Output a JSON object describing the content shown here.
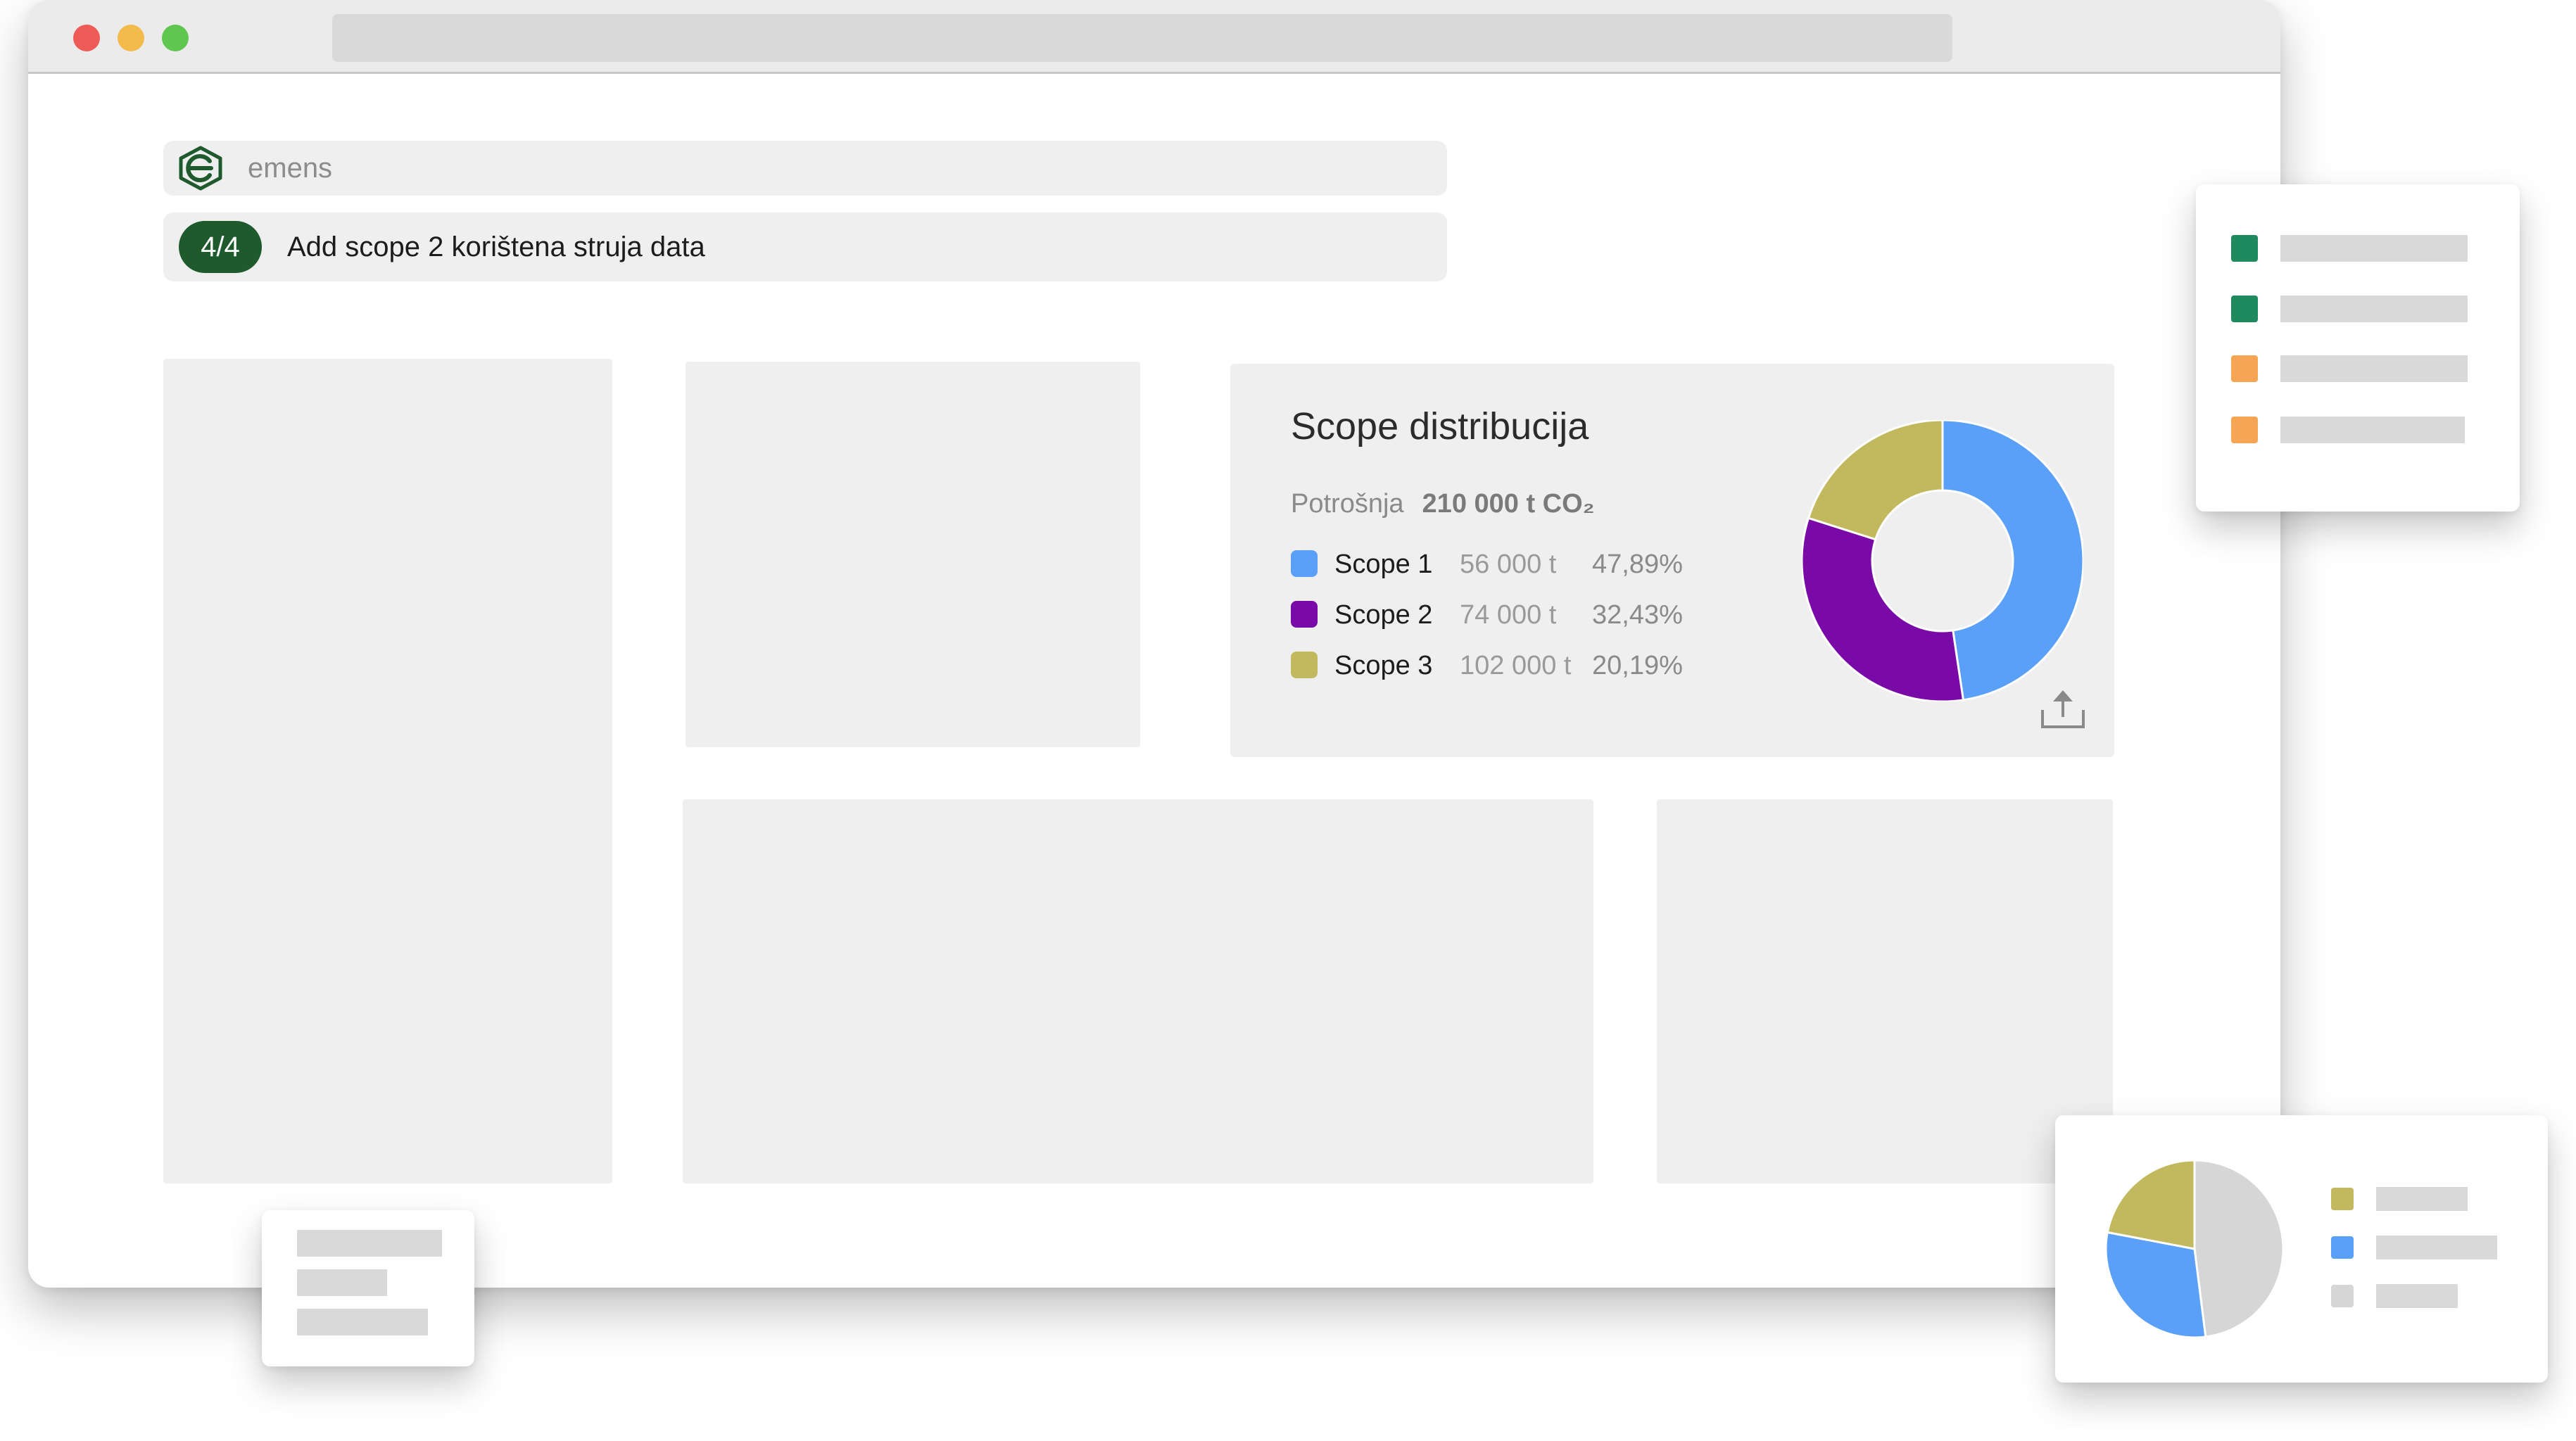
{
  "header": {
    "search_placeholder": "emens",
    "task_step": "4/4",
    "task_label": "Add scope 2 korištena struja data"
  },
  "scope_card": {
    "title": "Scope distribucija",
    "total_label": "Potrošnja",
    "total_value": "210 000 t CO₂",
    "legend": [
      {
        "name": "Scope 1",
        "amount": "56 000 t",
        "percent": "47,89%",
        "color": "#5ba0f8"
      },
      {
        "name": "Scope 2",
        "amount": "74 000 t",
        "percent": "32,43%",
        "color": "#7a0aa8"
      },
      {
        "name": "Scope 3",
        "amount": "102 000 t",
        "percent": "20,19%",
        "color": "#c2b85d"
      }
    ]
  },
  "chart_data": [
    {
      "type": "pie",
      "title": "Scope distribucija",
      "categories": [
        "Scope 1",
        "Scope 2",
        "Scope 3"
      ],
      "values": [
        47.89,
        32.43,
        20.19
      ],
      "colors": [
        "#5ba0f8",
        "#7a0aa8",
        "#c2b85d"
      ],
      "donut": true
    },
    {
      "type": "pie",
      "values": [
        48,
        30,
        22
      ],
      "colors": [
        "#d6d6d6",
        "#5ba0f8",
        "#c2b85d"
      ]
    }
  ],
  "legend_card": {
    "swatch_colors": [
      "#1e8a5e",
      "#1e8a5e",
      "#f5a553",
      "#f5a553"
    ]
  },
  "pie_card": {
    "swatch_colors": [
      "#c2b85d",
      "#5ba0f8",
      "#d6d6d6"
    ]
  },
  "icons": {
    "logo": "emens-logo-icon",
    "export": "upload-icon"
  }
}
